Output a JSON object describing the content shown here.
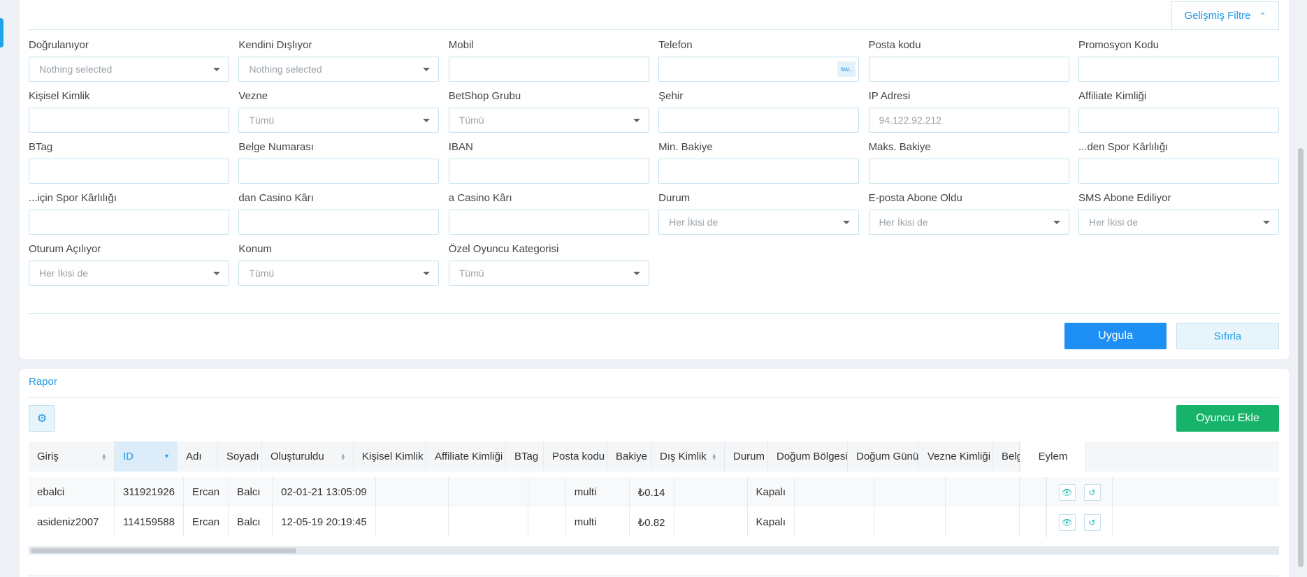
{
  "filters": {
    "toggle_label": "Gelişmiş Filtre",
    "fields": [
      {
        "label": "Doğrulanıyor",
        "type": "select",
        "value": "Nothing selected"
      },
      {
        "label": "Kendini Dışlıyor",
        "type": "select",
        "value": "Nothing selected"
      },
      {
        "label": "Mobil",
        "type": "input",
        "value": ""
      },
      {
        "label": "Telefon",
        "type": "input-sw",
        "value": "",
        "badge": "sw.."
      },
      {
        "label": "Posta kodu",
        "type": "input",
        "value": ""
      },
      {
        "label": "Promosyon Kodu",
        "type": "input",
        "value": ""
      },
      {
        "label": "Kişisel Kimlik",
        "type": "input",
        "value": ""
      },
      {
        "label": "Vezne",
        "type": "select",
        "value": "Tümü"
      },
      {
        "label": "BetShop Grubu",
        "type": "select",
        "value": "Tümü"
      },
      {
        "label": "Şehir",
        "type": "input",
        "value": ""
      },
      {
        "label": "IP Adresi",
        "type": "input",
        "value": "94.122.92.212"
      },
      {
        "label": "Affiliate Kimliği",
        "type": "input",
        "value": ""
      },
      {
        "label": "BTag",
        "type": "input",
        "value": ""
      },
      {
        "label": "Belge Numarası",
        "type": "input",
        "value": ""
      },
      {
        "label": "IBAN",
        "type": "input",
        "value": ""
      },
      {
        "label": "Min. Bakiye",
        "type": "input",
        "value": ""
      },
      {
        "label": "Maks. Bakiye",
        "type": "input",
        "value": ""
      },
      {
        "label": "...den Spor Kârlılığı",
        "type": "input",
        "value": ""
      },
      {
        "label": "...için Spor Kârlılığı",
        "type": "input",
        "value": ""
      },
      {
        "label": "dan Casino Kârı",
        "type": "input",
        "value": ""
      },
      {
        "label": "a Casino Kârı",
        "type": "input",
        "value": ""
      },
      {
        "label": "Durum",
        "type": "select",
        "value": "Her İkisi de"
      },
      {
        "label": "E-posta Abone Oldu",
        "type": "select",
        "value": "Her İkisi de"
      },
      {
        "label": "SMS Abone Ediliyor",
        "type": "select",
        "value": "Her İkisi de"
      },
      {
        "label": "Oturum Açılıyor",
        "type": "select",
        "value": "Her İkisi de"
      },
      {
        "label": "Konum",
        "type": "select",
        "value": "Tümü"
      },
      {
        "label": "Özel Oyuncu Kategorisi",
        "type": "select",
        "value": "Tümü"
      }
    ],
    "apply_label": "Uygula",
    "reset_label": "Sıfırla"
  },
  "report": {
    "title": "Rapor",
    "add_player_label": "Oyuncu Ekle",
    "columns": [
      {
        "label": "Giriş",
        "sortable": true
      },
      {
        "label": "ID",
        "sortable": true,
        "active": true
      },
      {
        "label": "Adı",
        "sortable": false
      },
      {
        "label": "Soyadı",
        "sortable": false
      },
      {
        "label": "Oluşturuldu",
        "sortable": true
      },
      {
        "label": "Kişisel Kimlik",
        "sortable": false
      },
      {
        "label": "Affiliate Kimliği",
        "sortable": false
      },
      {
        "label": "BTag",
        "sortable": false
      },
      {
        "label": "Posta kodu",
        "sortable": false
      },
      {
        "label": "Bakiye",
        "sortable": false
      },
      {
        "label": "Dış Kimlik",
        "sortable": true
      },
      {
        "label": "Durum",
        "sortable": false
      },
      {
        "label": "Doğum Bölgesi",
        "sortable": false
      },
      {
        "label": "Doğum Günü",
        "sortable": false
      },
      {
        "label": "Vezne Kimliği",
        "sortable": false
      },
      {
        "label": "Belg",
        "sortable": false
      }
    ],
    "action_column": "Eylem",
    "rows": [
      [
        "ebalci",
        "311921926",
        "Ercan",
        "Balcı",
        "02-01-21 13:05:09",
        "",
        "",
        "",
        "multi",
        "₺0.14",
        "",
        "Kapalı",
        "",
        "",
        "",
        ""
      ],
      [
        "asideniz2007",
        "114159588",
        "Ercan",
        "Balcı",
        "12-05-19 20:19:45",
        "",
        "",
        "",
        "multi",
        "₺0.82",
        "",
        "Kapalı",
        "",
        "",
        "",
        ""
      ]
    ]
  }
}
